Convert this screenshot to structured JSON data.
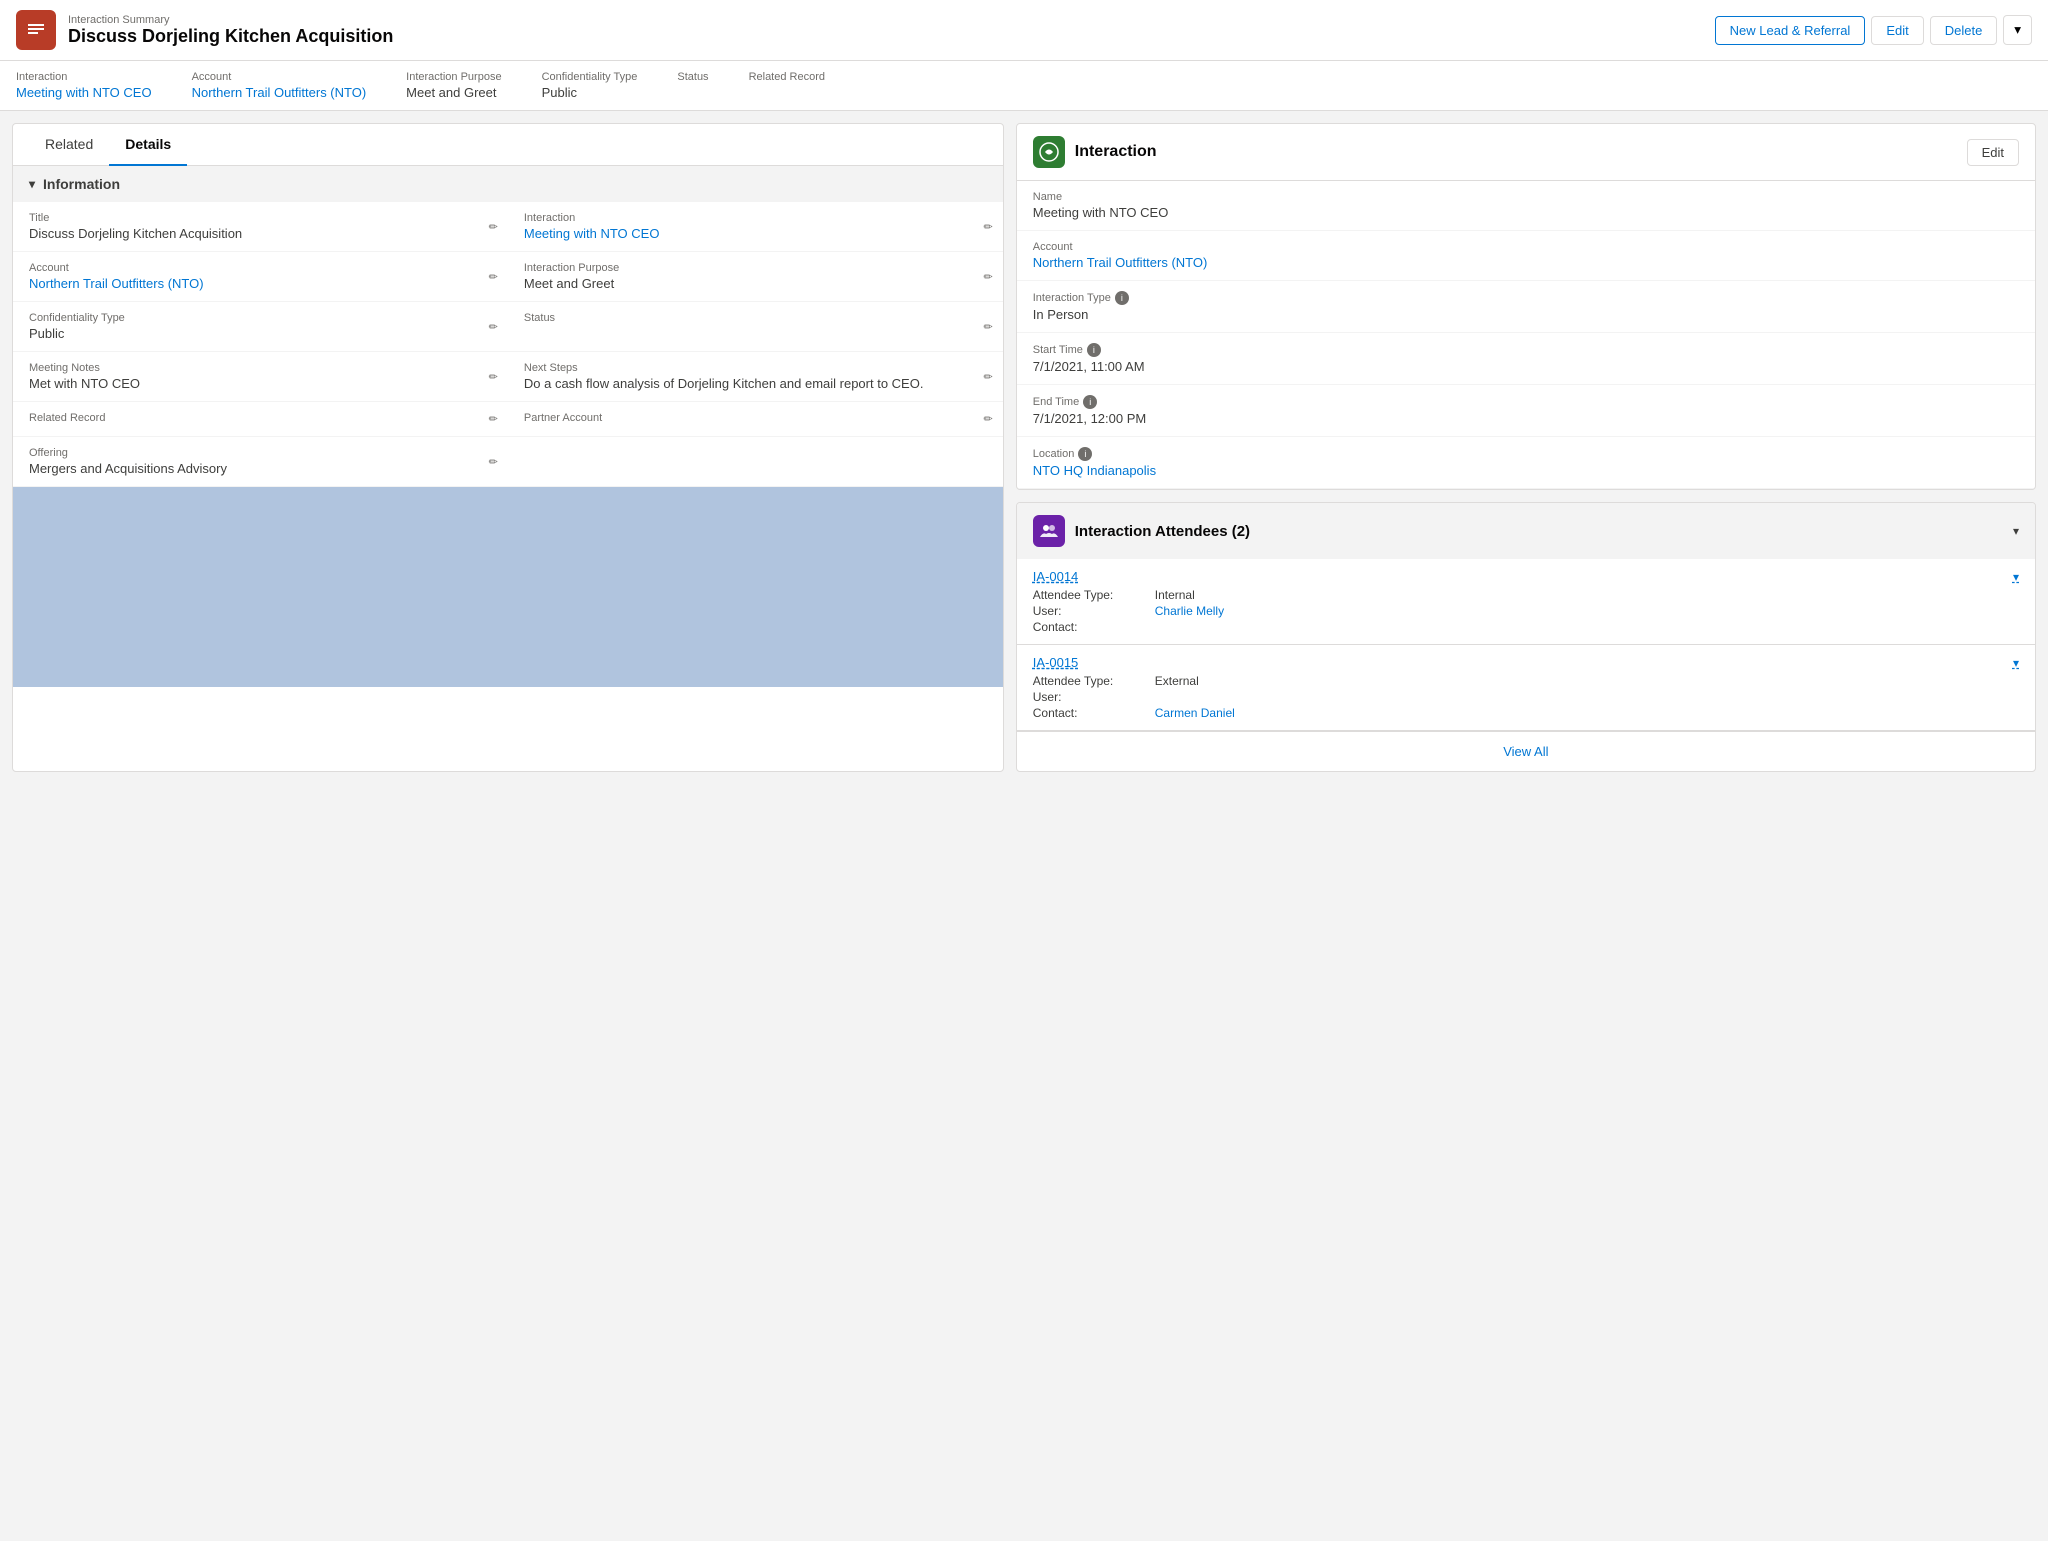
{
  "header": {
    "subtitle": "Interaction Summary",
    "title": "Discuss Dorjeling Kitchen Acquisition",
    "icon_label": "IS",
    "buttons": {
      "new_lead": "New Lead & Referral",
      "edit": "Edit",
      "delete": "Delete"
    }
  },
  "summary_bar": {
    "items": [
      {
        "label": "Interaction",
        "value": "Meeting with NTO CEO",
        "is_link": true
      },
      {
        "label": "Account",
        "value": "Northern Trail Outfitters (NTO)",
        "is_link": true
      },
      {
        "label": "Interaction Purpose",
        "value": "Meet and Greet",
        "is_link": false
      },
      {
        "label": "Confidentiality Type",
        "value": "Public",
        "is_link": false
      },
      {
        "label": "Status",
        "value": "",
        "is_link": false
      },
      {
        "label": "Related Record",
        "value": "",
        "is_link": false
      }
    ]
  },
  "tabs": {
    "related": "Related",
    "details": "Details",
    "active": "Details"
  },
  "information_section": {
    "title": "Information",
    "fields_left": [
      {
        "label": "Title",
        "value": "Discuss Dorjeling Kitchen Acquisition",
        "is_link": false,
        "editable": true
      },
      {
        "label": "Account",
        "value": "Northern Trail Outfitters (NTO)",
        "is_link": true,
        "editable": true
      },
      {
        "label": "Confidentiality Type",
        "value": "Public",
        "is_link": false,
        "editable": true
      },
      {
        "label": "Meeting Notes",
        "value": "Met with NTO CEO",
        "is_link": false,
        "editable": true
      },
      {
        "label": "Related Record",
        "value": "",
        "is_link": false,
        "editable": true
      },
      {
        "label": "Offering",
        "value": "Mergers and Acquisitions Advisory",
        "is_link": false,
        "editable": true
      }
    ],
    "fields_right": [
      {
        "label": "Interaction",
        "value": "Meeting with NTO CEO",
        "is_link": true,
        "editable": true
      },
      {
        "label": "Interaction Purpose",
        "value": "Meet and Greet",
        "is_link": false,
        "editable": true
      },
      {
        "label": "Status",
        "value": "",
        "is_link": false,
        "editable": true
      },
      {
        "label": "Next Steps",
        "value": "Do a cash flow analysis of Dorjeling Kitchen and email report to CEO.",
        "is_link": false,
        "editable": true
      },
      {
        "label": "Partner Account",
        "value": "",
        "is_link": false,
        "editable": true
      }
    ]
  },
  "interaction_card": {
    "title": "Interaction",
    "edit_label": "Edit",
    "fields": [
      {
        "label": "Name",
        "value": "Meeting with NTO CEO",
        "is_link": false,
        "has_info": false
      },
      {
        "label": "Account",
        "value": "Northern Trail Outfitters (NTO)",
        "is_link": true,
        "has_info": false
      },
      {
        "label": "Interaction Type",
        "value": "In Person",
        "is_link": false,
        "has_info": true
      },
      {
        "label": "Start Time",
        "value": "7/1/2021, 11:00 AM",
        "is_link": false,
        "has_info": true
      },
      {
        "label": "End Time",
        "value": "7/1/2021, 12:00 PM",
        "is_link": false,
        "has_info": true
      },
      {
        "label": "Location",
        "value": "NTO HQ Indianapolis",
        "is_link": true,
        "has_info": true
      }
    ]
  },
  "attendees_card": {
    "title": "Interaction Attendees (2)",
    "attendees": [
      {
        "id": "IA-0014",
        "type_label": "Attendee Type:",
        "type_value": "Internal",
        "user_label": "User:",
        "user_value": "Charlie Melly",
        "user_is_link": true,
        "contact_label": "Contact:",
        "contact_value": ""
      },
      {
        "id": "IA-0015",
        "type_label": "Attendee Type:",
        "type_value": "External",
        "user_label": "User:",
        "user_value": "",
        "user_is_link": false,
        "contact_label": "Contact:",
        "contact_value": "Carmen Daniel",
        "contact_is_link": true
      }
    ],
    "view_all": "View All"
  }
}
